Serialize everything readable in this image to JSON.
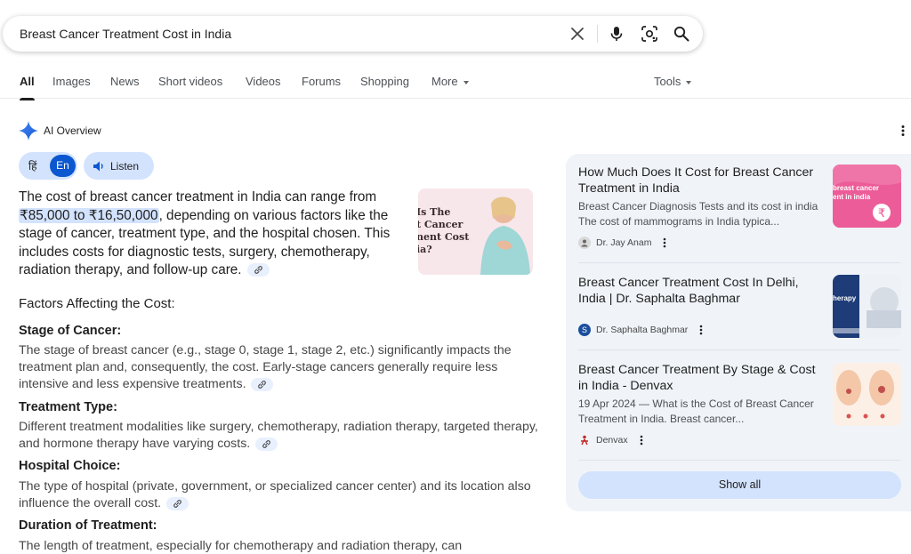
{
  "search": {
    "query": "Breast Cancer Treatment Cost in India"
  },
  "tabs": [
    {
      "label": "All"
    },
    {
      "label": "Images"
    },
    {
      "label": "News"
    },
    {
      "label": "Short videos"
    },
    {
      "label": "Videos"
    },
    {
      "label": "Forums"
    },
    {
      "label": "Shopping"
    },
    {
      "label": "More"
    }
  ],
  "tools_label": "Tools",
  "ai_overview": {
    "title": "AI Overview",
    "lang_hi": "हिं",
    "lang_en": "En",
    "listen_label": "Listen",
    "intro_before": "The cost of breast cancer treatment in India can range from ",
    "intro_highlight": "₹85,000 to ₹16,50,000",
    "intro_after": ", depending on various factors like the stage of cancer, treatment type, and the hospital chosen. This includes costs for diagnostic tests, surgery, chemotherapy, radiation therapy, and follow-up care.",
    "thumb_text": "Is The\nt Cancer\nnent Cost\nia?",
    "factors_heading": "Factors Affecting the Cost:",
    "factors": [
      {
        "heading": "Stage of Cancer:",
        "text": "The stage of breast cancer (e.g., stage 0, stage 1, stage 2, etc.) significantly impacts the treatment plan and, consequently, the cost. Early-stage cancers generally require less intensive and less expensive treatments."
      },
      {
        "heading": "Treatment Type:",
        "text": "Different treatment modalities like surgery, chemotherapy, radiation therapy, targeted therapy, and hormone therapy have varying costs."
      },
      {
        "heading": "Hospital Choice:",
        "text": "The type of hospital (private, government, or specialized cancer center) and its location also influence the overall cost."
      },
      {
        "heading": "Duration of Treatment:",
        "text": "The length of treatment, especially for chemotherapy and radiation therapy, can"
      }
    ]
  },
  "sources": [
    {
      "title": "How Much Does It Cost for Breast Cancer Treatment in India",
      "snippet": "Breast Cancer Diagnosis Tests and its cost in india The cost of mammograms in India typica...",
      "site": "Dr. Jay Anam",
      "thumb_text": "breast cancer\nent in india"
    },
    {
      "title": "Breast Cancer Treatment Cost In Delhi, India | Dr. Saphalta Baghmar",
      "snippet": "",
      "site": "Dr. Saphalta Baghmar",
      "thumb_text": "herapy"
    },
    {
      "title": "Breast Cancer Treatment By Stage & Cost in India - Denvax",
      "snippet": "19 Apr 2024 — What is the Cost of Breast Cancer Treatment in India. Breast cancer...",
      "site": "Denvax",
      "thumb_text": ""
    }
  ],
  "show_all_label": "Show all",
  "colors": {
    "accent": "#0b57d0",
    "chip": "#d3e3fd",
    "panel": "#f0f4f9"
  }
}
